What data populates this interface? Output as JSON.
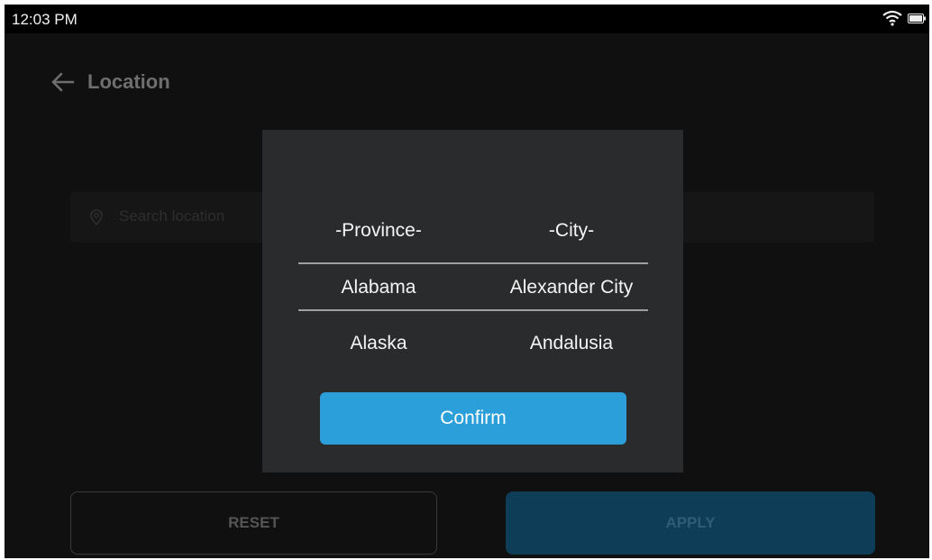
{
  "status_bar": {
    "time": "12:03 PM",
    "wifi_icon": "wifi-icon",
    "battery_icon": "battery-icon"
  },
  "header": {
    "back_icon": "arrow-left-icon",
    "title": "Location"
  },
  "search": {
    "icon": "location-pin-icon",
    "placeholder": "Search location"
  },
  "actions": {
    "reset_label": "RESET",
    "apply_label": "APPLY"
  },
  "dialog": {
    "columns": {
      "province_header": "-Province-",
      "city_header": "-City-"
    },
    "provinces": [
      "Alabama",
      "Alaska"
    ],
    "cities": [
      "Alexander City",
      "Andalusia"
    ],
    "selected_province": "Alabama",
    "selected_city": "Alexander City",
    "confirm_label": "Confirm"
  },
  "colors": {
    "accent": "#2b9fd9",
    "background": "#101010",
    "dialog": "#2a2b2c",
    "apply_disabled": "#0e3d57"
  }
}
